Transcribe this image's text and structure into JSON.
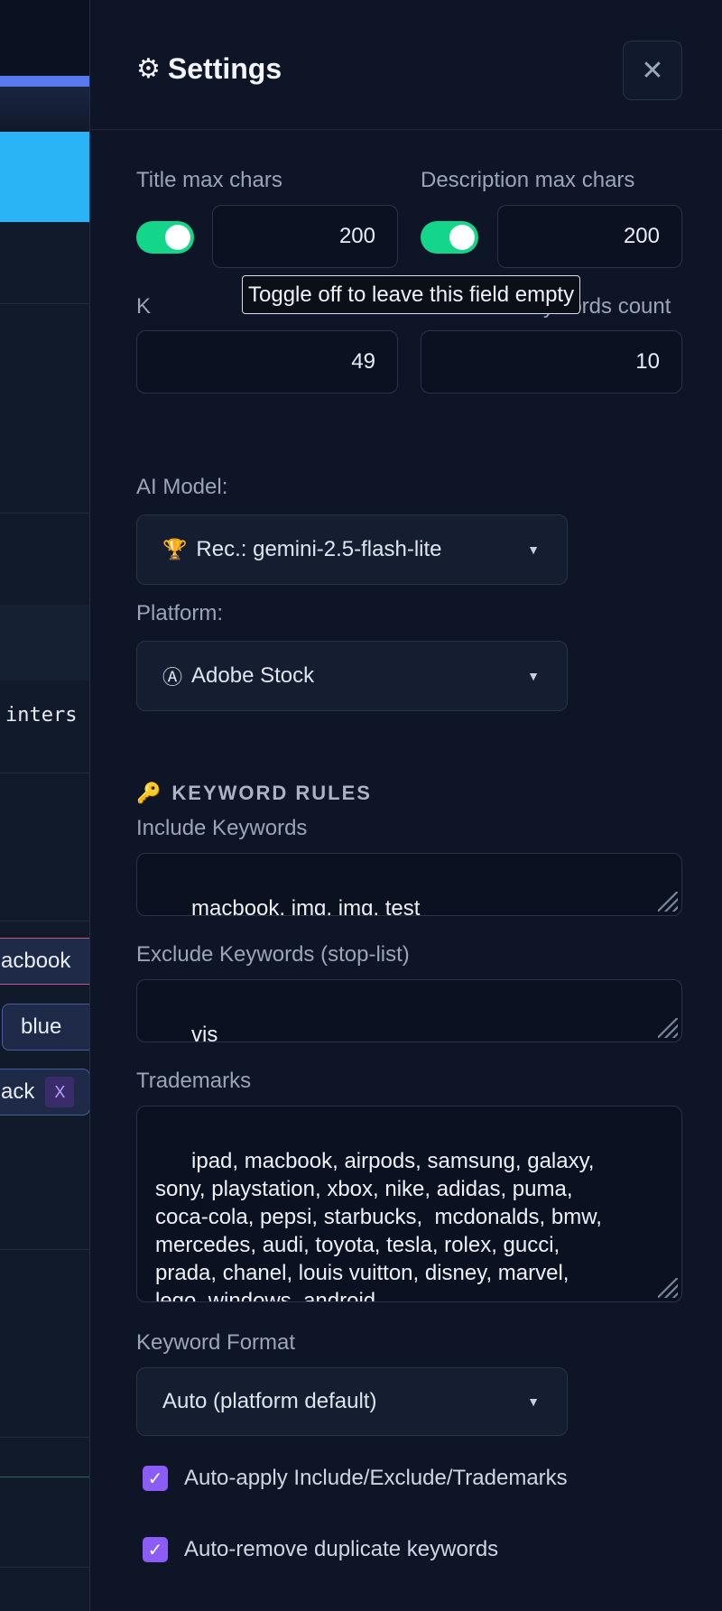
{
  "background": {
    "code_snippet": "inters",
    "chips": [
      {
        "label": "acbook",
        "remove_label": ""
      },
      {
        "label": "blue",
        "remove_label": ""
      },
      {
        "label": "ack",
        "remove_label": "X"
      }
    ]
  },
  "settings": {
    "title": "Settings",
    "title_icon": "gear-icon",
    "close_icon": "close-icon",
    "title_max": {
      "label": "Title max chars",
      "value": "200",
      "enabled": true
    },
    "description_max": {
      "label": "Description max chars",
      "value": "200",
      "enabled": true
    },
    "tooltip": "Toggle off to leave this field empty",
    "keywords_label_partial": "K",
    "keywords_count_label_partial": "ywords count",
    "keywords_value": "49",
    "keywords_count_value": "10",
    "ai_model": {
      "label": "AI Model:",
      "selected": "Rec.: gemini-2.5-flash-lite",
      "icon": "trophy-icon"
    },
    "platform": {
      "label": "Platform:",
      "selected": "Adobe Stock",
      "icon": "adobe-icon"
    },
    "keyword_rules": {
      "section_title": "KEYWORD RULES",
      "section_icon": "key-icon",
      "include": {
        "label": "Include Keywords",
        "value": "macbook, img, img, test"
      },
      "exclude": {
        "label": "Exclude Keywords (stop-list)",
        "value": "vis"
      },
      "trademarks": {
        "label": "Trademarks",
        "value": "ipad, macbook, airpods, samsung, galaxy,\nsony, playstation, xbox, nike, adidas, puma,\ncoca-cola, pepsi, starbucks,  mcdonalds, bmw,\nmercedes, audi, toyota, tesla, rolex, gucci,\nprada, chanel, louis vuitton, disney, marvel,\nlego, windows, android"
      },
      "format": {
        "label": "Keyword Format",
        "selected": "Auto (platform default)"
      },
      "auto_apply": {
        "label": "Auto-apply Include/Exclude/Trademarks",
        "checked": true
      },
      "auto_remove_dupes": {
        "label": "Auto-remove duplicate keywords",
        "checked": true
      }
    }
  }
}
